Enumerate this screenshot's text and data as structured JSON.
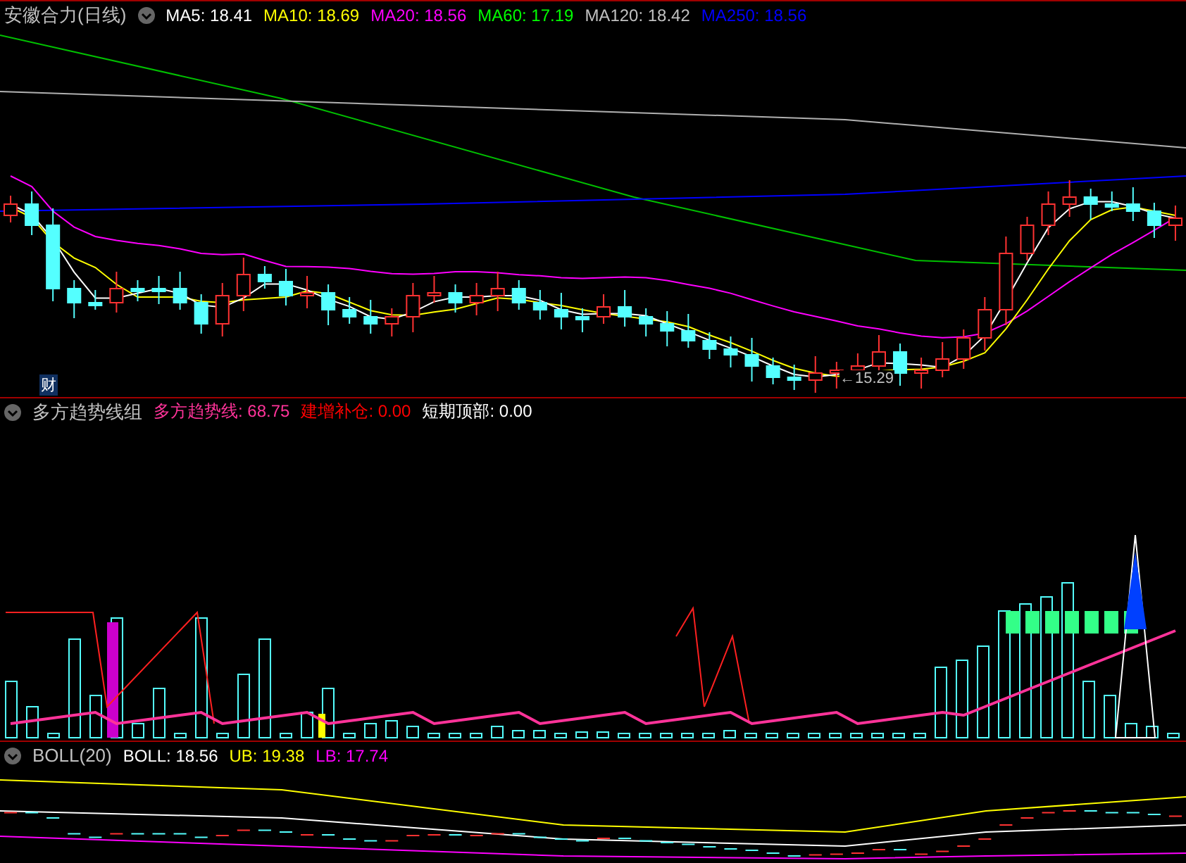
{
  "main_panel": {
    "title": "安徽合力(日线)",
    "ma": [
      {
        "label": "MA5: 18.41",
        "color": "#ffffff"
      },
      {
        "label": "MA10: 18.69",
        "color": "#ffff00"
      },
      {
        "label": "MA20: 18.56",
        "color": "#ff00ff"
      },
      {
        "label": "MA60: 17.19",
        "color": "#00ff00"
      },
      {
        "label": "MA120: 18.42",
        "color": "#c0c0c0"
      },
      {
        "label": "MA250: 18.56",
        "color": "#0000ff"
      }
    ],
    "low_marker": "←15.29",
    "badge": "财"
  },
  "indicator_panel": {
    "title": "多方趋势线组",
    "items": [
      {
        "label": "多方趋势线: 68.75",
        "color": "#ff3399"
      },
      {
        "label": "建增补仓: 0.00",
        "color": "#ff0000"
      },
      {
        "label": "短期顶部: 0.00",
        "color": "#ffffff"
      }
    ]
  },
  "boll_panel": {
    "title": "BOLL(20)",
    "items": [
      {
        "label": "BOLL: 18.56",
        "color": "#ffffff"
      },
      {
        "label": "UB: 19.38",
        "color": "#ffff00"
      },
      {
        "label": "LB: 17.74",
        "color": "#ff00ff"
      }
    ]
  }
}
